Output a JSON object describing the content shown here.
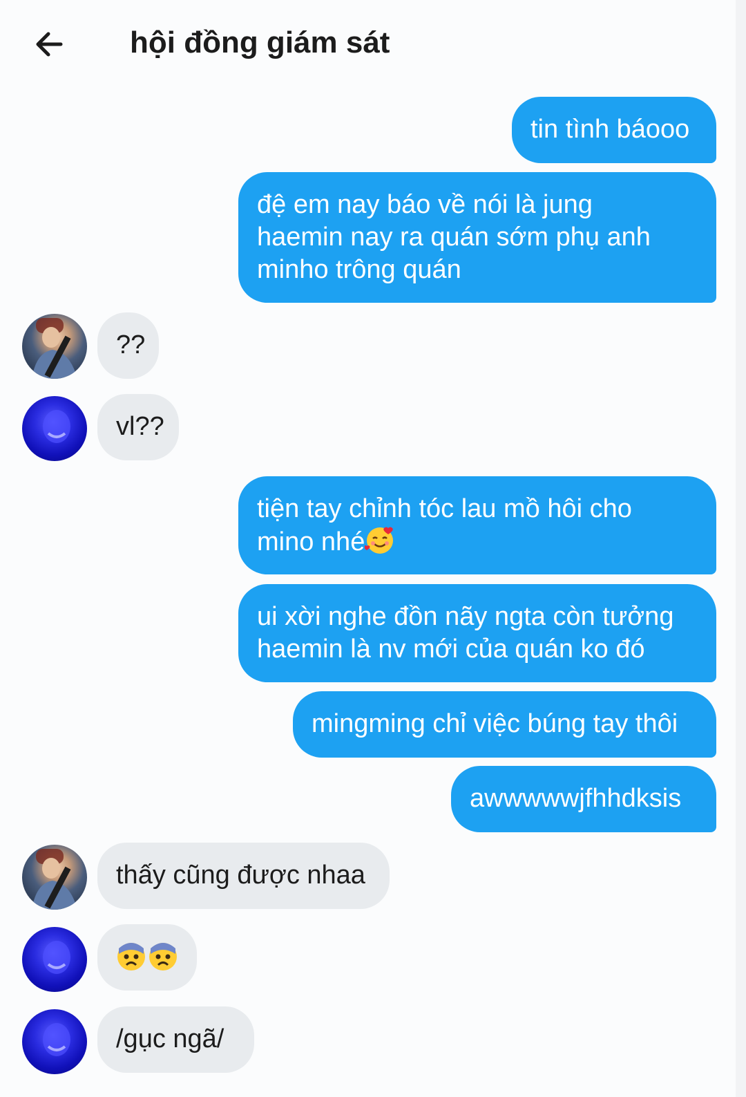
{
  "header": {
    "title": "hội đồng giám sát",
    "back_icon": "arrow-left-icon"
  },
  "colors": {
    "outgoing_bubble": "#1da1f2",
    "incoming_bubble": "#e8ebee"
  },
  "messages": [
    {
      "direction": "outgoing",
      "lines": [
        "tin tình báooo"
      ]
    },
    {
      "direction": "outgoing",
      "lines": [
        "đệ em nay báo về nói là jung",
        "haemin nay ra quán sớm phụ anh",
        "minho trông quán"
      ]
    },
    {
      "direction": "incoming",
      "sender": "avatar-guitarist",
      "lines": [
        "??"
      ]
    },
    {
      "direction": "incoming",
      "sender": "avatar-blue",
      "lines": [
        "vl??"
      ]
    },
    {
      "direction": "outgoing",
      "lines": [
        "tiện tay chỉnh tóc lau mồ hôi cho",
        "mino nhé"
      ],
      "emoji": "smiling-face-with-hearts"
    },
    {
      "direction": "outgoing",
      "lines": [
        "ui xời nghe đồn nãy ngta còn tưởng",
        "haemin là nv mới của quán ko đó"
      ]
    },
    {
      "direction": "outgoing",
      "lines": [
        "mingming chỉ việc búng tay thôi"
      ]
    },
    {
      "direction": "outgoing",
      "lines": [
        "awwwwwjfhhdksis"
      ]
    },
    {
      "direction": "incoming",
      "sender": "avatar-guitarist",
      "lines": [
        "thấy cũng được nhaa"
      ]
    },
    {
      "direction": "incoming",
      "sender": "avatar-blue",
      "lines": [],
      "emoji": "fearful-face x2"
    },
    {
      "direction": "incoming",
      "sender": "avatar-blue",
      "lines": [
        "/gục ngã/"
      ]
    }
  ]
}
